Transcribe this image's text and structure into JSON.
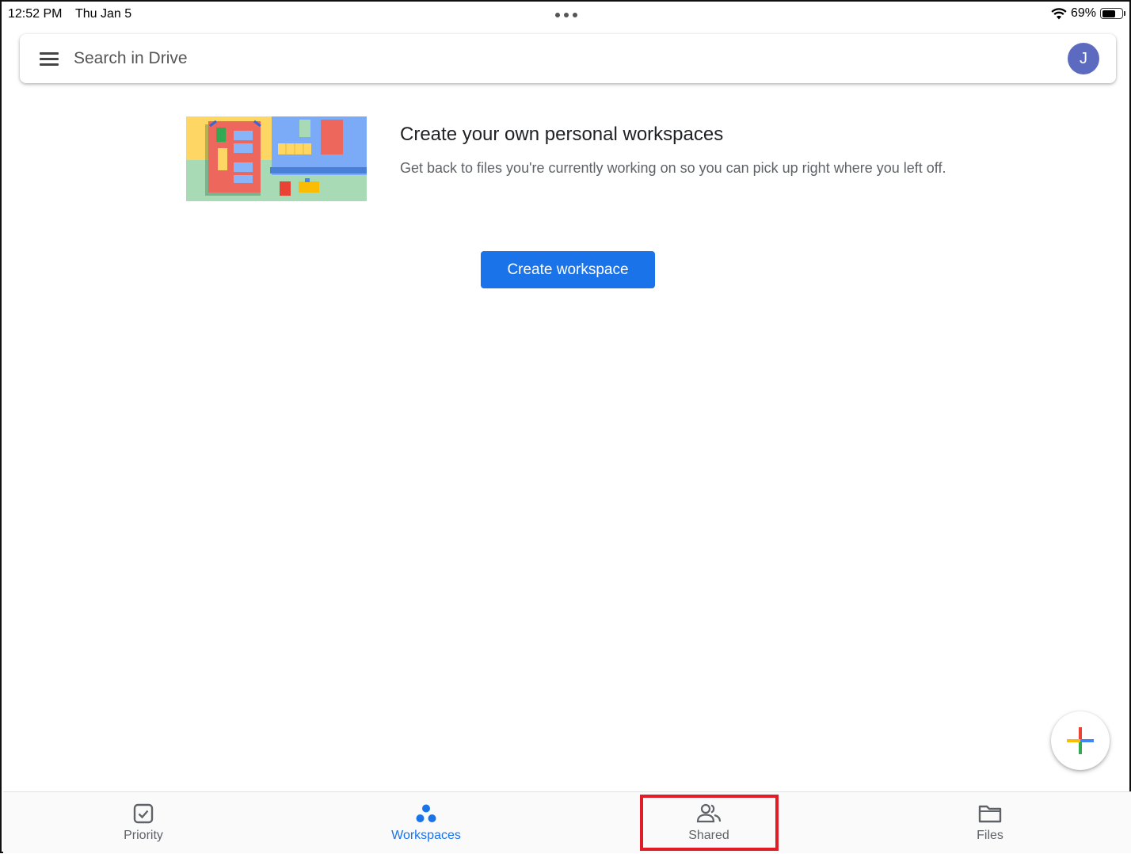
{
  "status_bar": {
    "time": "12:52 PM",
    "date": "Thu Jan 5",
    "battery": "69%",
    "battery_level": 0.69
  },
  "search": {
    "placeholder": "Search in Drive",
    "menu_icon": "menu-icon",
    "avatar_initial": "J",
    "avatar_color": "#5c6bc0"
  },
  "promo": {
    "title": "Create your own personal workspaces",
    "description": "Get back to files you're currently working on so you can pick up right where you left off.",
    "button_label": "Create workspace",
    "button_color": "#1a73e8"
  },
  "fab": {
    "icon": "plus-icon"
  },
  "bottom_nav": {
    "items": [
      {
        "label": "Priority",
        "icon": "priority-icon"
      },
      {
        "label": "Workspaces",
        "icon": "workspaces-icon",
        "active": true
      },
      {
        "label": "Shared",
        "icon": "shared-icon"
      },
      {
        "label": "Files",
        "icon": "folder-icon"
      }
    ],
    "active_color": "#1a73e8",
    "highlight_color": "#e01d27"
  }
}
